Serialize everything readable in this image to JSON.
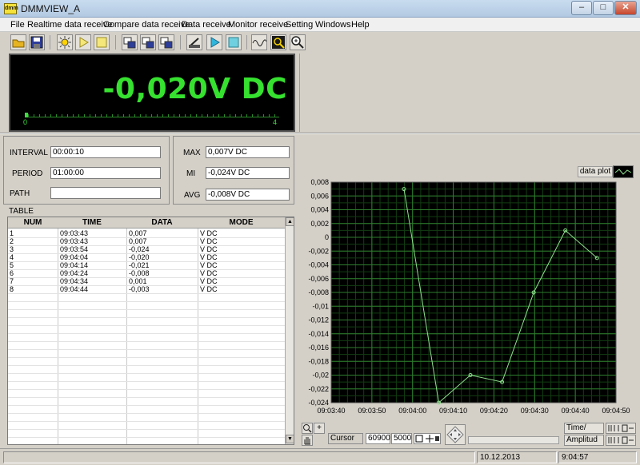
{
  "window": {
    "title": "DMMVIEW_A",
    "icon_text": "dmm",
    "minimize": "–",
    "maximize": "□",
    "close": "✕"
  },
  "menu": [
    "File",
    "Realtime data receive",
    "Compare data receive",
    "Data receive",
    "Monitor receive",
    "Setting",
    "Windows",
    "Help"
  ],
  "toolbar_icons": [
    "open-folder-icon",
    "save-icon",
    "settings-sun-icon",
    "play-yellow-icon",
    "stop-yellow-icon",
    "transfer-1-icon",
    "transfer-2-icon",
    "transfer-3-icon",
    "meter-probe-icon",
    "play-blue-icon",
    "stop-blue-icon",
    "waveform-icon",
    "cursor-zoom-icon",
    "magnifier-icon"
  ],
  "display": {
    "reading": "-0,020V DC",
    "scale_min": "0",
    "scale_max": "4",
    "color": "#36e12f"
  },
  "params": {
    "interval_label": "INTERVAL",
    "interval_value": "00:00:10",
    "period_label": "PERIOD",
    "period_value": "01:00:00",
    "path_label": "PATH",
    "path_value": ""
  },
  "stats": {
    "max_label": "MAX",
    "max_value": "0,007V DC",
    "min_label": "MI",
    "min_value": "-0,024V DC",
    "avg_label": "AVG",
    "avg_value": "-0,008V DC"
  },
  "table": {
    "caption": "TABLE",
    "columns": [
      "NUM",
      "TIME",
      "DATA",
      "MODE"
    ],
    "rows": [
      [
        "1",
        "09:03:43",
        "0,007",
        "V DC"
      ],
      [
        "2",
        "09:03:43",
        "0,007",
        "V DC"
      ],
      [
        "3",
        "09:03:54",
        "-0,024",
        "V DC"
      ],
      [
        "4",
        "09:04:04",
        "-0,020",
        "V DC"
      ],
      [
        "5",
        "09:04:14",
        "-0,021",
        "V DC"
      ],
      [
        "6",
        "09:04:24",
        "-0,008",
        "V DC"
      ],
      [
        "7",
        "09:04:34",
        "0,001",
        "V DC"
      ],
      [
        "8",
        "09:04:44",
        "-0,003",
        "V DC"
      ]
    ]
  },
  "plot": {
    "legend_label": "data plot",
    "cursor_label": "Cursor",
    "cursor_x": "60900",
    "cursor_y": "5000",
    "x_axis_name": "Time/",
    "y_axis_name": "Amplitud",
    "zoom_tool": "magnifier-plus-icon",
    "pan_tool": "hand-icon",
    "plus": "+"
  },
  "chart_data": {
    "type": "line",
    "x": [
      "09:03:43",
      "09:03:54",
      "09:04:04",
      "09:04:14",
      "09:04:24",
      "09:04:34",
      "09:04:44"
    ],
    "x_seconds": [
      3,
      14,
      24,
      34,
      44,
      54,
      64
    ],
    "values": [
      0.007,
      -0.024,
      -0.02,
      -0.021,
      -0.008,
      0.001,
      -0.003
    ],
    "xlim_seconds": [
      -20,
      70
    ],
    "x_ticks": [
      "09:03:40",
      "09:03:50",
      "09:04:00",
      "09:04:10",
      "09:04:20",
      "09:04:30",
      "09:04:40",
      "09:04:50"
    ],
    "ylim": [
      -0.024,
      0.008
    ],
    "y_ticks": [
      "0,008",
      "0,006",
      "0,004",
      "0,002",
      "0",
      "-0,002",
      "-0,004",
      "-0,006",
      "-0,008",
      "-0,01",
      "-0,012",
      "-0,014",
      "-0,016",
      "-0,018",
      "-0,02",
      "-0,022",
      "-0,024"
    ],
    "grid": true,
    "line_color": "#8fe08f",
    "background": "#000000"
  },
  "status": {
    "left": "",
    "date": "10.12.2013",
    "time": "9:04:57"
  }
}
